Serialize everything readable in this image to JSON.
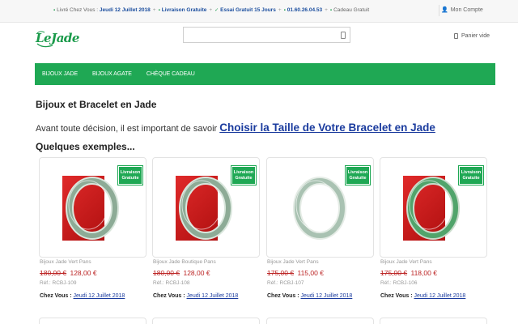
{
  "topbar": {
    "items": [
      {
        "icon": "truck-icon",
        "label": "Livré Chez Vous :",
        "highlight": "Jeudi 12 Juillet 2018"
      },
      {
        "icon": "gift-icon",
        "label": "Livraison Gratuite"
      },
      {
        "icon": "check-icon",
        "label": "Essai Gratuit 15 Jours"
      },
      {
        "icon": "phone-icon",
        "label": "01.60.26.04.53"
      },
      {
        "icon": "gift-icon",
        "label": "Cadeau Gratuit"
      }
    ],
    "account_label": "Mon Compte"
  },
  "header": {
    "logo_text": "LeJade",
    "search_placeholder": "",
    "cart_label": "Panier vide"
  },
  "nav": {
    "items": [
      "BIJOUX JADE",
      "BIJOUX AGATE",
      "CHÈQUE CADEAU"
    ]
  },
  "content": {
    "title": "Bijoux et Bracelet en Jade",
    "intro_text": "Avant toute décision, il est important de savoir",
    "intro_link": "Choisir la Taille de Votre Bracelet en Jade",
    "examples_heading": "Quelques exemples..."
  },
  "products": [
    {
      "name": "Bijoux Jade Vert Pans",
      "old_price": "180,00 €",
      "new_price": "128,00 €",
      "ref": "Réf.: RCBJ-109",
      "badge": "Livraison Gratuite",
      "delivery_label": "Chez Vous :",
      "delivery_date": "Jeudi 12 Juillet 2018",
      "red_box": true,
      "jade_color": "#7fa08a",
      "rim_color": "#d9e6dc"
    },
    {
      "name": "Bijoux Jade Boutique Pans",
      "old_price": "180,00 €",
      "new_price": "128,00 €",
      "ref": "Réf.: RCBJ-108",
      "badge": "Livraison Gratuite",
      "delivery_label": "Chez Vous :",
      "delivery_date": "Jeudi 12 Juillet 2018",
      "red_box": true,
      "jade_color": "#7fa08a",
      "rim_color": "#d9e6dc"
    },
    {
      "name": "Bijoux Jade Vert Pans",
      "old_price": "175,00 €",
      "new_price": "115,00 €",
      "ref": "Réf.: RCBJ-107",
      "badge": "Livraison Gratuite",
      "delivery_label": "Chez Vous :",
      "delivery_date": "Jeudi 12 Juillet 2018",
      "red_box": false,
      "jade_color": "#9fbba8",
      "rim_color": "#e5ece6"
    },
    {
      "name": "Bijoux Jade Vert Pans",
      "old_price": "175,00 €",
      "new_price": "118,00 €",
      "ref": "Réf.: RCBJ-106",
      "badge": "Livraison Gratuite",
      "delivery_label": "Chez Vous :",
      "delivery_date": "Jeudi 12 Juillet 2018",
      "red_box": true,
      "jade_color": "#3c9a5a",
      "rim_color": "#c9dccb"
    }
  ],
  "colors": {
    "brand_green": "#1fa854",
    "price_red": "#b22222",
    "link_blue": "#1a3b9e"
  }
}
